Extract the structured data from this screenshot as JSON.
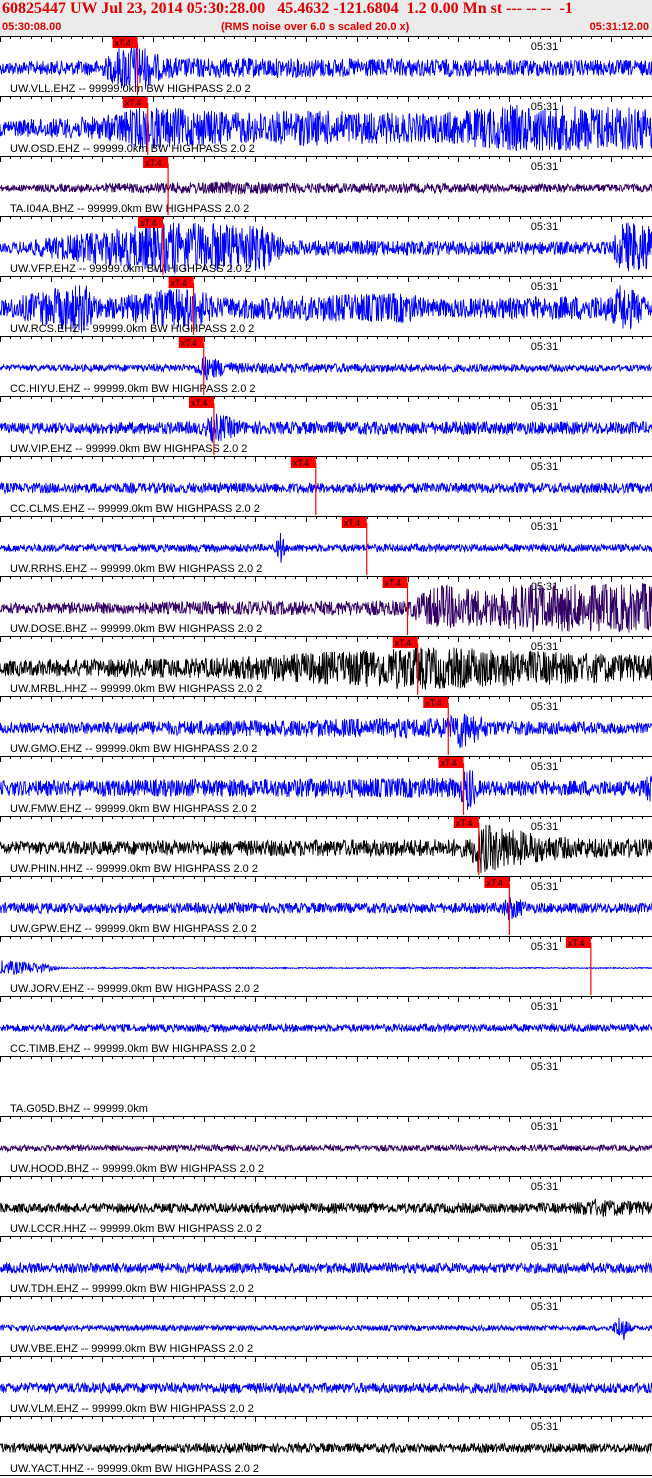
{
  "header": {
    "title": "60825447 UW Jul 23, 2014 05:30:28.00   45.4632 -121.6804  1.2 0.00 Mn st --- -- --  -1",
    "start_time": "05:30:08.00",
    "noise_note": "(RMS noise over 6.0 s scaled 20.0 x)",
    "end_time": "05:31:12.00"
  },
  "colors": {
    "header_bg": "#ebebeb",
    "header_text": "#e00000",
    "pick_marker": "#ff0000",
    "blue": "#0000ff",
    "purple": "#330066",
    "black": "#000000"
  },
  "chart_data": {
    "type": "seismogram",
    "time_start": "05:30:08.00",
    "time_end": "05:31:12.00",
    "minute_label": "05:31",
    "pick_label": "xT.4",
    "traces": [
      {
        "label": "UW.VLL.EHZ -- 99999.0km BW  HIGHPASS  2.0  2",
        "color": "blue",
        "pick_time_s": 13.5,
        "envelope": [
          [
            0,
            0.25
          ],
          [
            10,
            0.3
          ],
          [
            12,
            0.9
          ],
          [
            13.5,
            1.0
          ],
          [
            16,
            0.4
          ],
          [
            64,
            0.3
          ]
        ]
      },
      {
        "label": "UW.OSD.EHZ -- 99999.0km BW  HIGHPASS  2.0  2",
        "color": "blue",
        "pick_time_s": 14.5,
        "envelope": [
          [
            0,
            0.3
          ],
          [
            10,
            0.45
          ],
          [
            14,
            0.85
          ],
          [
            24,
            0.6
          ],
          [
            30,
            0.7
          ],
          [
            42,
            0.55
          ],
          [
            50,
            0.9
          ],
          [
            64,
            0.85
          ]
        ]
      },
      {
        "label": "TA.I04A.BHZ -- 99999.0km BW  HIGHPASS  2.0  2",
        "color": "purple",
        "pick_time_s": 16.5,
        "envelope": [
          [
            0,
            0.12
          ],
          [
            24,
            0.25
          ],
          [
            30,
            0.2
          ],
          [
            64,
            0.15
          ]
        ]
      },
      {
        "label": "UW.VFP.EHZ -- 99999.0km BW  HIGHPASS  2.0  2",
        "color": "blue",
        "pick_time_s": 16.0,
        "envelope": [
          [
            0,
            0.15
          ],
          [
            16,
            1.0
          ],
          [
            26,
            0.9
          ],
          [
            28,
            0.3
          ],
          [
            60,
            0.25
          ],
          [
            61,
            1.0
          ],
          [
            64,
            1.0
          ]
        ]
      },
      {
        "label": "UW.RCS.EHZ -- 99999.0km BW  HIGHPASS  2.0  2",
        "color": "blue",
        "pick_time_s": 19.0,
        "envelope": [
          [
            0,
            0.3
          ],
          [
            8,
            1.0
          ],
          [
            10,
            0.35
          ],
          [
            19,
            0.9
          ],
          [
            21,
            0.4
          ],
          [
            40,
            0.6
          ],
          [
            42,
            0.35
          ],
          [
            60,
            0.5
          ],
          [
            61,
            1.0
          ],
          [
            64,
            0.3
          ]
        ]
      },
      {
        "label": "CC.HIYU.EHZ -- 99999.0km BW  HIGHPASS  2.0  2",
        "color": "blue",
        "pick_time_s": 20.0,
        "envelope": [
          [
            0,
            0.12
          ],
          [
            19,
            0.15
          ],
          [
            20,
            0.5
          ],
          [
            23,
            0.2
          ],
          [
            64,
            0.12
          ]
        ]
      },
      {
        "label": "UW.VIP.EHZ -- 99999.0km BW  HIGHPASS  2.0  2",
        "color": "blue",
        "pick_time_s": 21.0,
        "envelope": [
          [
            0,
            0.2
          ],
          [
            20,
            0.25
          ],
          [
            21,
            0.6
          ],
          [
            24,
            0.25
          ],
          [
            64,
            0.25
          ]
        ]
      },
      {
        "label": "CC.CLMS.EHZ -- 99999.0km BW  HIGHPASS  2.0  2",
        "color": "blue",
        "pick_time_s": 31.0,
        "envelope": [
          [
            0,
            0.2
          ],
          [
            64,
            0.2
          ]
        ]
      },
      {
        "label": "UW.RRHS.EHZ -- 99999.0km BW  HIGHPASS  2.0  2",
        "color": "blue",
        "pick_time_s": 36.0,
        "envelope": [
          [
            0,
            0.15
          ],
          [
            27,
            0.15
          ],
          [
            27.5,
            0.7
          ],
          [
            28,
            0.15
          ],
          [
            64,
            0.15
          ]
        ]
      },
      {
        "label": "UW.DOSE.BHZ -- 99999.0km BW  HIGHPASS  2.0  2",
        "color": "purple",
        "pick_time_s": 40.0,
        "envelope": [
          [
            0,
            0.2
          ],
          [
            40,
            0.3
          ],
          [
            43,
            0.9
          ],
          [
            48,
            0.7
          ],
          [
            52,
            0.95
          ],
          [
            58,
            0.9
          ],
          [
            64,
            1.0
          ]
        ]
      },
      {
        "label": "UW.MRBL.HHZ -- 99999.0km BW  HIGHPASS  2.0  2",
        "color": "black",
        "pick_time_s": 41.0,
        "envelope": [
          [
            0,
            0.3
          ],
          [
            22,
            0.4
          ],
          [
            41,
            0.85
          ],
          [
            50,
            0.7
          ],
          [
            64,
            0.5
          ]
        ]
      },
      {
        "label": "UW.GMO.EHZ -- 99999.0km BW  HIGHPASS  2.0  2",
        "color": "blue",
        "pick_time_s": 44.0,
        "envelope": [
          [
            0,
            0.2
          ],
          [
            44,
            0.4
          ],
          [
            45,
            0.85
          ],
          [
            48,
            0.3
          ],
          [
            64,
            0.2
          ]
        ]
      },
      {
        "label": "UW.FMW.EHZ -- 99999.0km BW  HIGHPASS  2.0  2",
        "color": "blue",
        "pick_time_s": 45.5,
        "envelope": [
          [
            0,
            0.3
          ],
          [
            45,
            0.4
          ],
          [
            46,
            1.0
          ],
          [
            47,
            0.3
          ],
          [
            63,
            0.3
          ],
          [
            64,
            0.7
          ]
        ]
      },
      {
        "label": "UW.PHIN.HHZ -- 99999.0km BW  HIGHPASS  2.0  2",
        "color": "black",
        "pick_time_s": 47.0,
        "envelope": [
          [
            0,
            0.25
          ],
          [
            46,
            0.35
          ],
          [
            47,
            1.0
          ],
          [
            52,
            0.6
          ],
          [
            56,
            0.4
          ],
          [
            64,
            0.35
          ]
        ]
      },
      {
        "label": "UW.GPW.EHZ -- 99999.0km BW  HIGHPASS  2.0  2",
        "color": "blue",
        "pick_time_s": 50.0,
        "envelope": [
          [
            0,
            0.2
          ],
          [
            49,
            0.2
          ],
          [
            50,
            0.5
          ],
          [
            52,
            0.2
          ],
          [
            64,
            0.2
          ]
        ]
      },
      {
        "label": "UW.JORV.EHZ -- 99999.0km BW  HIGHPASS  2.0  2",
        "color": "blue",
        "pick_time_s": 58.0,
        "envelope": [
          [
            0,
            0.3
          ],
          [
            4,
            0.2
          ],
          [
            6,
            0.03
          ],
          [
            64,
            0.02
          ]
        ]
      },
      {
        "label": "CC.TIMB.EHZ -- 99999.0km BW  HIGHPASS  2.0  2",
        "color": "blue",
        "pick_time_s": null,
        "envelope": [
          [
            0,
            0.15
          ],
          [
            64,
            0.15
          ]
        ]
      },
      {
        "label": "TA.G05D.BHZ -- 99999.0km",
        "color": "none",
        "pick_time_s": null,
        "envelope": []
      },
      {
        "label": "UW.HOOD.BHZ -- 99999.0km BW  HIGHPASS  2.0  2",
        "color": "purple",
        "pick_time_s": null,
        "envelope": [
          [
            0,
            0.12
          ],
          [
            64,
            0.12
          ]
        ]
      },
      {
        "label": "UW.LCCR.HHZ -- 99999.0km BW  HIGHPASS  2.0  2",
        "color": "black",
        "pick_time_s": null,
        "envelope": [
          [
            0,
            0.18
          ],
          [
            56,
            0.2
          ],
          [
            58,
            0.35
          ],
          [
            64,
            0.25
          ]
        ]
      },
      {
        "label": "UW.TDH.EHZ -- 99999.0km BW  HIGHPASS  2.0  2",
        "color": "blue",
        "pick_time_s": null,
        "envelope": [
          [
            0,
            0.2
          ],
          [
            64,
            0.2
          ]
        ]
      },
      {
        "label": "UW.VBE.EHZ -- 99999.0km BW  HIGHPASS  2.0  2",
        "color": "blue",
        "pick_time_s": null,
        "envelope": [
          [
            0,
            0.12
          ],
          [
            60,
            0.1
          ],
          [
            61,
            0.6
          ],
          [
            62,
            0.1
          ],
          [
            64,
            0.1
          ]
        ]
      },
      {
        "label": "UW.VLM.EHZ -- 99999.0km BW  HIGHPASS  2.0  2",
        "color": "blue",
        "pick_time_s": null,
        "envelope": [
          [
            0,
            0.2
          ],
          [
            64,
            0.2
          ]
        ]
      },
      {
        "label": "UW.YACT.HHZ -- 99999.0km BW  HIGHPASS  2.0  2",
        "color": "black",
        "pick_time_s": null,
        "envelope": [
          [
            0,
            0.18
          ],
          [
            64,
            0.18
          ]
        ]
      }
    ]
  }
}
